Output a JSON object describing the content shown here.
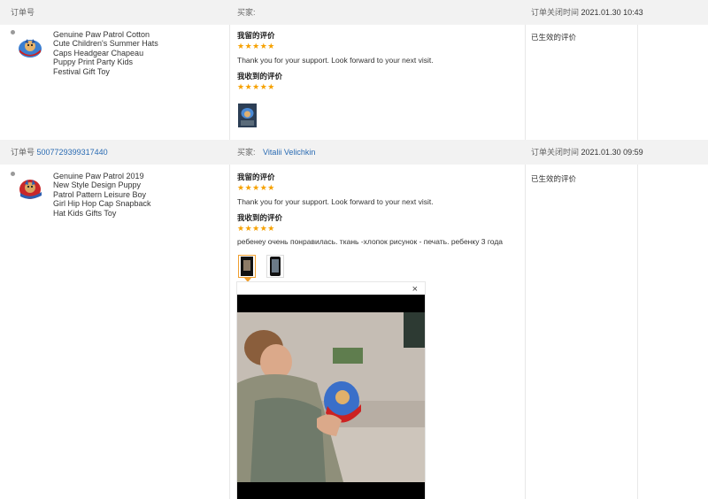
{
  "orders": [
    {
      "order_label": "订单号",
      "order_number": "",
      "buyer_label": "买家:",
      "buyer_name": "",
      "closed_label": "订单关闭时间",
      "closed_time": "2021.01.30 10:43",
      "product_title": "Genuine Paw Patrol Cotton Cute Children's Summer Hats Caps Headgear Chapeau Puppy Print Party Kids Festival Gift Toy",
      "my_review_label": "我留的评价",
      "my_review_stars": "★★★★★",
      "my_review_text": "Thank you for your support. Look forward to your next visit.",
      "received_review_label": "我收到的评价",
      "received_review_stars": "★★★★★",
      "received_review_text": "",
      "status": "已生效的评价"
    },
    {
      "order_label": "订单号",
      "order_number": "5007729399317440",
      "buyer_label": "买家:",
      "buyer_name": "Vitalii Velichkin",
      "closed_label": "订单关闭时间",
      "closed_time": "2021.01.30 09:59",
      "product_title": "Genuine Paw Patrol 2019 New Style Design Puppy Patrol Pattern Leisure Boy Girl Hip Hop Cap Snapback Hat Kids Gifts Toy",
      "my_review_label": "我留的评价",
      "my_review_stars": "★★★★★",
      "my_review_text": "Thank you for your support. Look forward to your next visit.",
      "received_review_label": "我收到的评价",
      "received_review_stars": "★★★★★",
      "received_review_text": "ребенеу очень понравилась. ткань -хлопок рисунок - печать. ребенку 3 года",
      "status": "已生效的评价"
    }
  ],
  "viewer": {
    "close_glyph": "×"
  },
  "colors": {
    "link": "#2a6bb3",
    "star": "#f6a100",
    "header_bg": "#f2f2f2"
  }
}
